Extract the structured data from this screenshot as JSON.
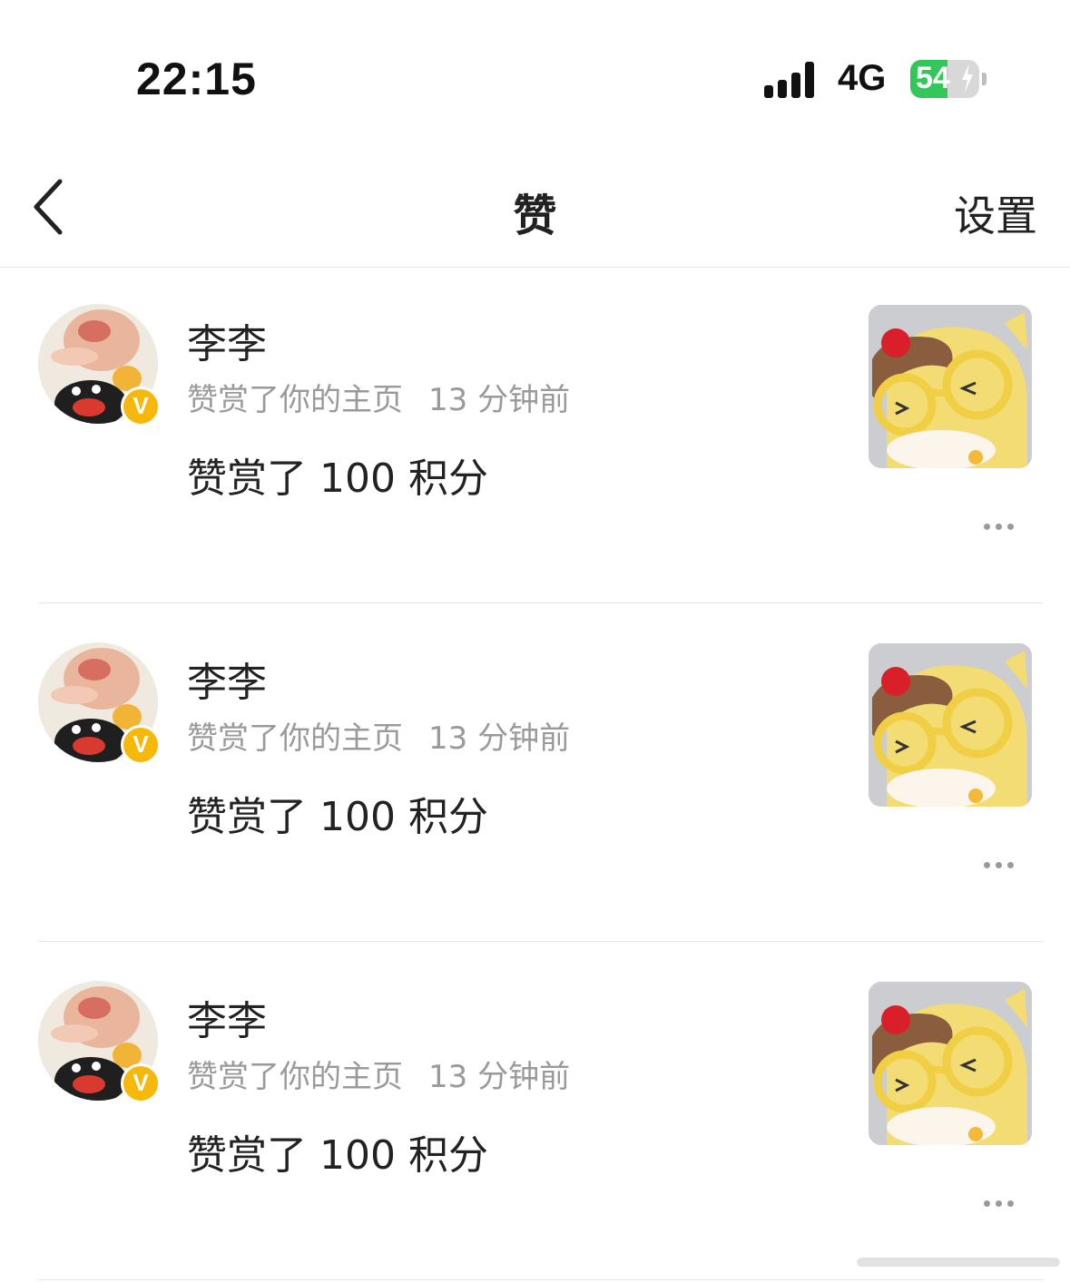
{
  "status_bar": {
    "time": "22:15",
    "network": "4G",
    "battery": "54",
    "battery_level": 0.54,
    "battery_color": "#33c759",
    "signal_icon": "signal-bars-icon",
    "charging_icon": "lightning-bolt-icon"
  },
  "nav": {
    "back_icon": "chevron-left-icon",
    "title": "赞",
    "settings_label": "设置"
  },
  "notifications": [
    {
      "user_name": "李李",
      "action": "赞赏了你的主页",
      "time": "13 分钟前",
      "content": "赞赏了 100 积分",
      "badge": "V",
      "badge_color": "#f6b80b"
    },
    {
      "user_name": "李李",
      "action": "赞赏了你的主页",
      "time": "13 分钟前",
      "content": "赞赏了 100 积分",
      "badge": "V",
      "badge_color": "#f6b80b"
    },
    {
      "user_name": "李李",
      "action": "赞赏了你的主页",
      "time": "13 分钟前",
      "content": "赞赏了 100 积分",
      "badge": "V",
      "badge_color": "#f6b80b"
    }
  ]
}
